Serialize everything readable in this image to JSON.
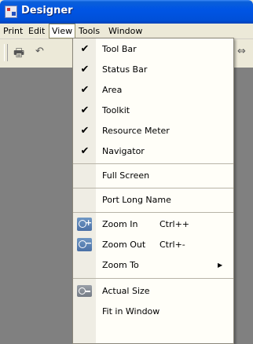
{
  "window": {
    "title": "Designer"
  },
  "menubar": {
    "items": [
      {
        "label": "Print"
      },
      {
        "label": "Edit"
      },
      {
        "label": "View"
      },
      {
        "label": "Tools"
      },
      {
        "label": "Window"
      }
    ]
  },
  "view_menu": {
    "toggles": [
      {
        "label": "Tool Bar",
        "checked": "✔"
      },
      {
        "label": "Status Bar",
        "checked": "✔"
      },
      {
        "label": "Area",
        "checked": "✔"
      },
      {
        "label": "Toolkit",
        "checked": "✔"
      },
      {
        "label": "Resource Meter",
        "checked": "✔"
      },
      {
        "label": "Navigator",
        "checked": "✔"
      }
    ],
    "full_screen": "Full Screen",
    "port_long_name": "Port Long Name",
    "zoom_in": {
      "label": "Zoom In",
      "shortcut": "Ctrl++",
      "icon": "zoom-in-icon"
    },
    "zoom_out": {
      "label": "Zoom Out",
      "shortcut": "Ctrl+-",
      "icon": "zoom-out-icon"
    },
    "zoom_to": {
      "label": "Zoom To",
      "arrow": "▶"
    },
    "actual_size": {
      "label": "Actual Size",
      "icon": "actual-size-icon"
    },
    "fit_in_window": "Fit in Window"
  },
  "colors": {
    "titlebar": "#0055e5",
    "menu_background": "#fffef8",
    "mdi_background": "#808080",
    "icon_blue": "#4a70a6"
  }
}
